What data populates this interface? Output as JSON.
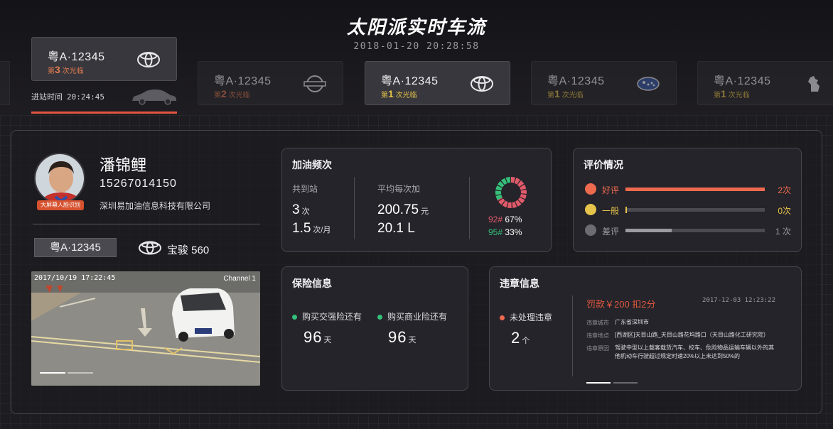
{
  "header": {
    "title": "太阳派实时车流",
    "datetime": "2018-01-20 20:28:58"
  },
  "carousel": {
    "current": {
      "plate": "粤A·12345",
      "visit_prefix": "第",
      "visit_count": "3",
      "visit_suffix": "次光临",
      "brand_icon": "toyota-logo-icon",
      "entry_label": "进站时间",
      "entry_time": "20:24:45"
    },
    "items": [
      {
        "plate": "粤A·12345",
        "visit_prefix": "第",
        "visit_count": "2",
        "visit_suffix": "次光临",
        "brand_icon": "nissan-logo-icon"
      },
      {
        "plate": "粤A·12345",
        "visit_prefix": "第",
        "visit_count": "1",
        "visit_suffix": "次光临",
        "brand_icon": "toyota-logo-icon"
      },
      {
        "plate": "粤A·12345",
        "visit_prefix": "第",
        "visit_count": "1",
        "visit_suffix": "次光临",
        "brand_icon": "subaru-logo-icon"
      },
      {
        "plate": "粤A·12345",
        "visit_prefix": "第",
        "visit_count": "1",
        "visit_suffix": "次光临",
        "brand_icon": "peugeot-logo-icon"
      }
    ]
  },
  "customer": {
    "name": "潘锦鲤",
    "phone": "15267014150",
    "company": "深圳易加油信息科技有限公司",
    "face_tag": "大屏幕人脸识别",
    "plate": "粤A·12345",
    "model": "宝骏 560",
    "camera_timestamp": "2017/10/19 17:22:45",
    "camera_channel": "Channel 1"
  },
  "fuel": {
    "title": "加油频次",
    "total_label": "共到站",
    "total_value": "3",
    "total_unit": "次",
    "rate_value": "1.5",
    "rate_unit": "次/月",
    "avg_label": "平均每次加",
    "avg_amount": "200.75",
    "avg_amount_unit": "元",
    "avg_volume": "20.1 L",
    "grades": [
      {
        "name": "92#",
        "share": "67%",
        "fraction": 0.67,
        "color": "#e25a6a"
      },
      {
        "name": "95#",
        "share": "33%",
        "fraction": 0.33,
        "color": "#35c07a"
      }
    ]
  },
  "rating": {
    "title": "评价情况",
    "rows": [
      {
        "label": "好评",
        "value": "2次",
        "fraction": 1.0,
        "color": "#ee6a4f"
      },
      {
        "label": "一般",
        "value": "0次",
        "fraction": 0.0,
        "color": "#e6c34a"
      },
      {
        "label": "差评",
        "value": "1 次",
        "fraction": 0.33,
        "color": "#9a9aa0"
      }
    ]
  },
  "insurance": {
    "title": "保险信息",
    "compulsory_label": "购买交强险还有",
    "compulsory_days": "96",
    "commercial_label": "购买商业险还有",
    "commercial_days": "96",
    "day_unit": "天",
    "dot_color": "#35c07a"
  },
  "violation": {
    "title": "违章信息",
    "unhandled_label": "未处理违章",
    "unhandled_count": "2",
    "count_unit": "个",
    "fine": "罚款￥200 扣2分",
    "date": "2017-12-03 12:23:22",
    "city_key": "违章城市",
    "city_val": "广东省深圳市",
    "place_key": "违章地点",
    "place_val": "[西湖区]天目山路_天目山路花坞路口（天目山路化工研究院）",
    "reason_key": "违章原因",
    "reason_val": "驾驶中型以上载客载货汽车、校车、危险物品运输车辆以外的其他机动车行驶超过规定时速20%以上未达到50%的",
    "dot_color": "#ee6a4f"
  }
}
